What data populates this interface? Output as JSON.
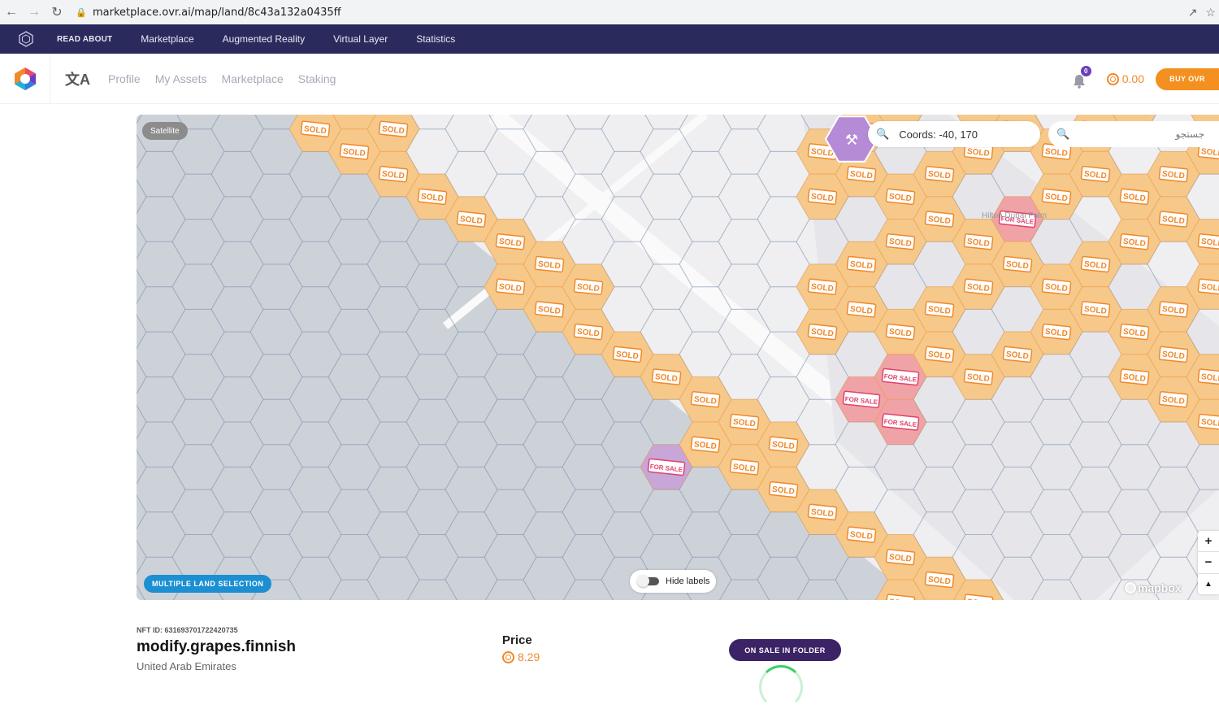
{
  "browser": {
    "url": "marketplace.ovr.ai/map/land/8c43a132a0435ff"
  },
  "top_nav": {
    "items": [
      "READ ABOUT",
      "Marketplace",
      "Augmented Reality",
      "Virtual Layer",
      "Statistics"
    ]
  },
  "header": {
    "menu": [
      "Profile",
      "My Assets",
      "Marketplace",
      "Staking"
    ],
    "notification_count": "0",
    "balance": "0.00",
    "buy_label": "BUY OVR"
  },
  "map": {
    "satellite_label": "Satellite",
    "coords_text": "Coords: -40, 170",
    "search_placeholder": "جستجو",
    "multi_select_label": "MULTIPLE LAND SELECTION",
    "hide_labels_label": "Hide labels",
    "zoom_in": "+",
    "zoom_out": "−",
    "compass": "▲",
    "attribution": "mapbox",
    "place_label": "Hilton Dubai Palm",
    "sold_label": "SOLD",
    "for_sale_label": "FOR SALE",
    "colors": {
      "sold_fill": "#f6c98a",
      "for_sale_fill": "#f0a3a7",
      "selected_fill": "#c8a6d8",
      "water": "#cdd2d9",
      "land": "#efeff1"
    }
  },
  "land": {
    "nft_id": "NFT ID: 631693701722420735",
    "name": "modify.grapes.finnish",
    "country": "United Arab Emirates",
    "price_title": "Price",
    "price": "8.29",
    "sale_status": "ON SALE IN FOLDER"
  }
}
